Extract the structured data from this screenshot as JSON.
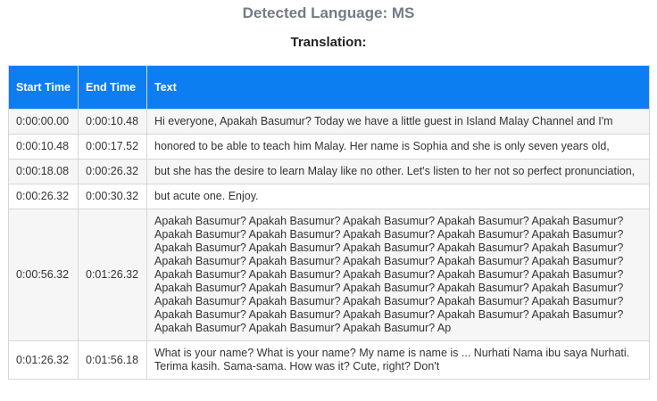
{
  "header": {
    "detected_language": "Detected Language: MS",
    "translation_heading": "Translation:"
  },
  "table": {
    "columns": [
      "Start Time",
      "End Time",
      "Text"
    ],
    "rows": [
      {
        "start": "0:00:00.00",
        "end": "0:00:10.48",
        "text": "Hi everyone, Apakah Basumur? Today we have a little guest in Island Malay Channel and I'm"
      },
      {
        "start": "0:00:10.48",
        "end": "0:00:17.52",
        "text": "honored to be able to teach him Malay. Her name is Sophia and she is only seven years old,"
      },
      {
        "start": "0:00:18.08",
        "end": "0:00:26.32",
        "text": "but she has the desire to learn Malay like no other. Let's listen to her not so perfect pronunciation,"
      },
      {
        "start": "0:00:26.32",
        "end": "0:00:30.32",
        "text": "but acute one. Enjoy."
      },
      {
        "start": "0:00:56.32",
        "end": "0:01:26.32",
        "text": "Apakah Basumur? Apakah Basumur? Apakah Basumur? Apakah Basumur? Apakah Basumur? Apakah Basumur? Apakah Basumur? Apakah Basumur? Apakah Basumur? Apakah Basumur? Apakah Basumur? Apakah Basumur? Apakah Basumur? Apakah Basumur? Apakah Basumur? Apakah Basumur? Apakah Basumur? Apakah Basumur? Apakah Basumur? Apakah Basumur? Apakah Basumur? Apakah Basumur? Apakah Basumur? Apakah Basumur? Apakah Basumur? Apakah Basumur? Apakah Basumur? Apakah Basumur? Apakah Basumur? Apakah Basumur? Apakah Basumur? Apakah Basumur? Apakah Basumur? Apakah Basumur? Apakah Basumur? Apakah Basumur? Apakah Basumur? Apakah Basumur? Apakah Basumur? Apakah Basumur? Apakah Basumur? Apakah Basumur? Apakah Basumur? Ap"
      },
      {
        "start": "0:01:26.32",
        "end": "0:01:56.18",
        "text": "What is your name? What is your name? My name is name is ... Nurhati Nama ibu saya Nurhati. Terima kasih. Sama-sama. How was it? Cute, right? Don't"
      }
    ]
  },
  "colors": {
    "header_background": "#0d7df2",
    "header_text": "#ffffff",
    "stripe": "#f6f6f6",
    "title_gray": "#737b86"
  }
}
